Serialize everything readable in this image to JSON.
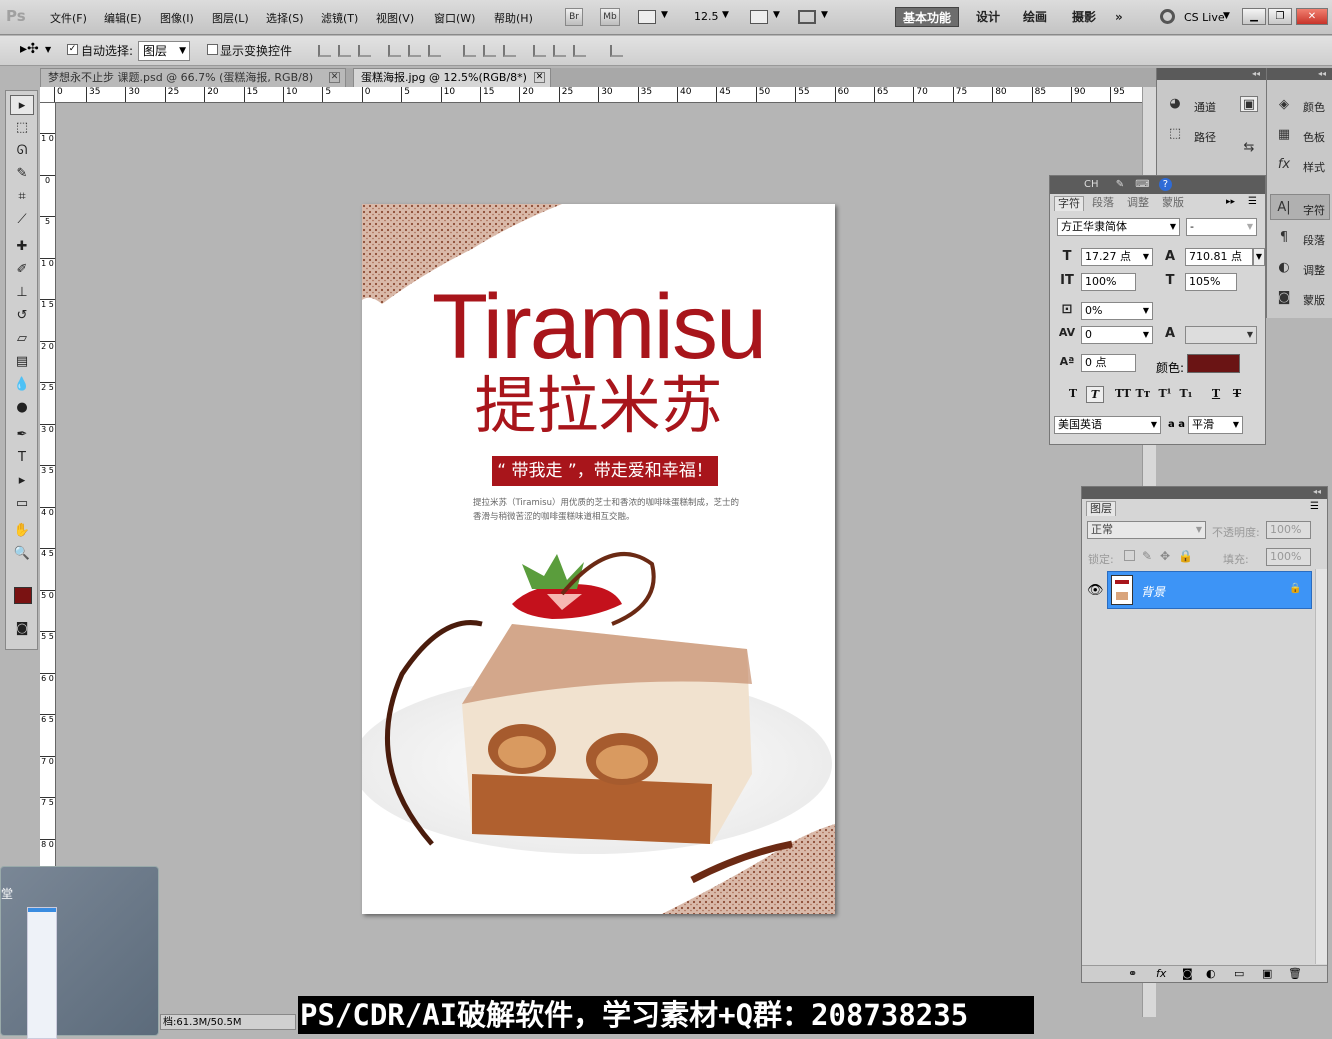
{
  "menubar": {
    "logo": "Ps",
    "items": [
      "文件(F)",
      "编辑(E)",
      "图像(I)",
      "图层(L)",
      "选择(S)",
      "滤镜(T)",
      "视图(V)",
      "窗口(W)",
      "帮助(H)"
    ],
    "bridge_label": "Br",
    "minibridge_label": "Mb",
    "zoom": "12.5",
    "workspaces": [
      "基本功能",
      "设计",
      "绘画",
      "摄影"
    ],
    "more": "»",
    "cslive": "CS Live"
  },
  "options": {
    "auto_select_label": "自动选择:",
    "auto_select_value": "图层",
    "show_transform_label": "显示变换控件"
  },
  "tabs": [
    {
      "label": "梦想永不止步 课题.psd @ 66.7% (蛋糕海报, RGB/8)"
    },
    {
      "label": "蛋糕海报.jpg @ 12.5%(RGB/8*)"
    }
  ],
  "ruler": {
    "h_labels": [
      "0",
      "35",
      "30",
      "25",
      "20",
      "15",
      "10",
      "5",
      "0",
      "5",
      "10",
      "15",
      "20",
      "25",
      "30",
      "35",
      "40",
      "45",
      "50",
      "55",
      "60",
      "65",
      "70",
      "75",
      "80",
      "85",
      "90",
      "95"
    ],
    "v_labels": [
      "1 0",
      "0",
      "5",
      "1 0",
      "1 5",
      "2 0",
      "2 5",
      "3 0",
      "3 5",
      "4 0",
      "4 5",
      "5 0",
      "5 5",
      "6 0",
      "6 5",
      "7 0",
      "7 5",
      "8 0"
    ]
  },
  "poster": {
    "title_en": "Tiramisu",
    "title_cn": "提拉米苏",
    "slogan": "“ 带我走 ”，带走爱和幸福！",
    "desc_line1": "提拉米苏（Tiramisu）用优质的芝士和香浓的咖啡味蛋糕制成，芝士的",
    "desc_line2": "香滑与稍微苦涩的咖啡蛋糕味道相互交融。"
  },
  "dock_left": {
    "items": [
      "通道",
      "路径"
    ]
  },
  "dock_right": {
    "items": [
      "颜色",
      "色板",
      "样式",
      "字符",
      "段落",
      "调整",
      "蒙版"
    ]
  },
  "character": {
    "title": "CH",
    "tabs": [
      "字符",
      "段落",
      "调整",
      "蒙版"
    ],
    "font_family": "方正华隶简体",
    "font_style": "-",
    "font_size": "17.27 点",
    "leading": "710.81 点",
    "vscale": "100%",
    "hscale": "105%",
    "tsume": "0%",
    "kerning": "0",
    "baseline": "0 点",
    "color_label": "颜色:",
    "color_swatch": "#6a1414",
    "language": "美国英语",
    "aa_label": "a a",
    "antialias": "平滑"
  },
  "layers": {
    "tab": "图层",
    "blend_mode": "正常",
    "opacity_label": "不透明度:",
    "opacity": "100%",
    "lock_label": "锁定:",
    "fill_label": "填充:",
    "fill": "100%",
    "layer_name": "背景"
  },
  "thumbwin": {
    "label": "堂"
  },
  "status": {
    "doc": "档:61.3M/50.5M"
  },
  "banner": {
    "text": "PS/CDR/AI破解软件，学习素材+Q群：208738235"
  },
  "colors": {
    "fg": "#7a1212",
    "bg": "#1f3a24",
    "accent": "#a8151b"
  }
}
